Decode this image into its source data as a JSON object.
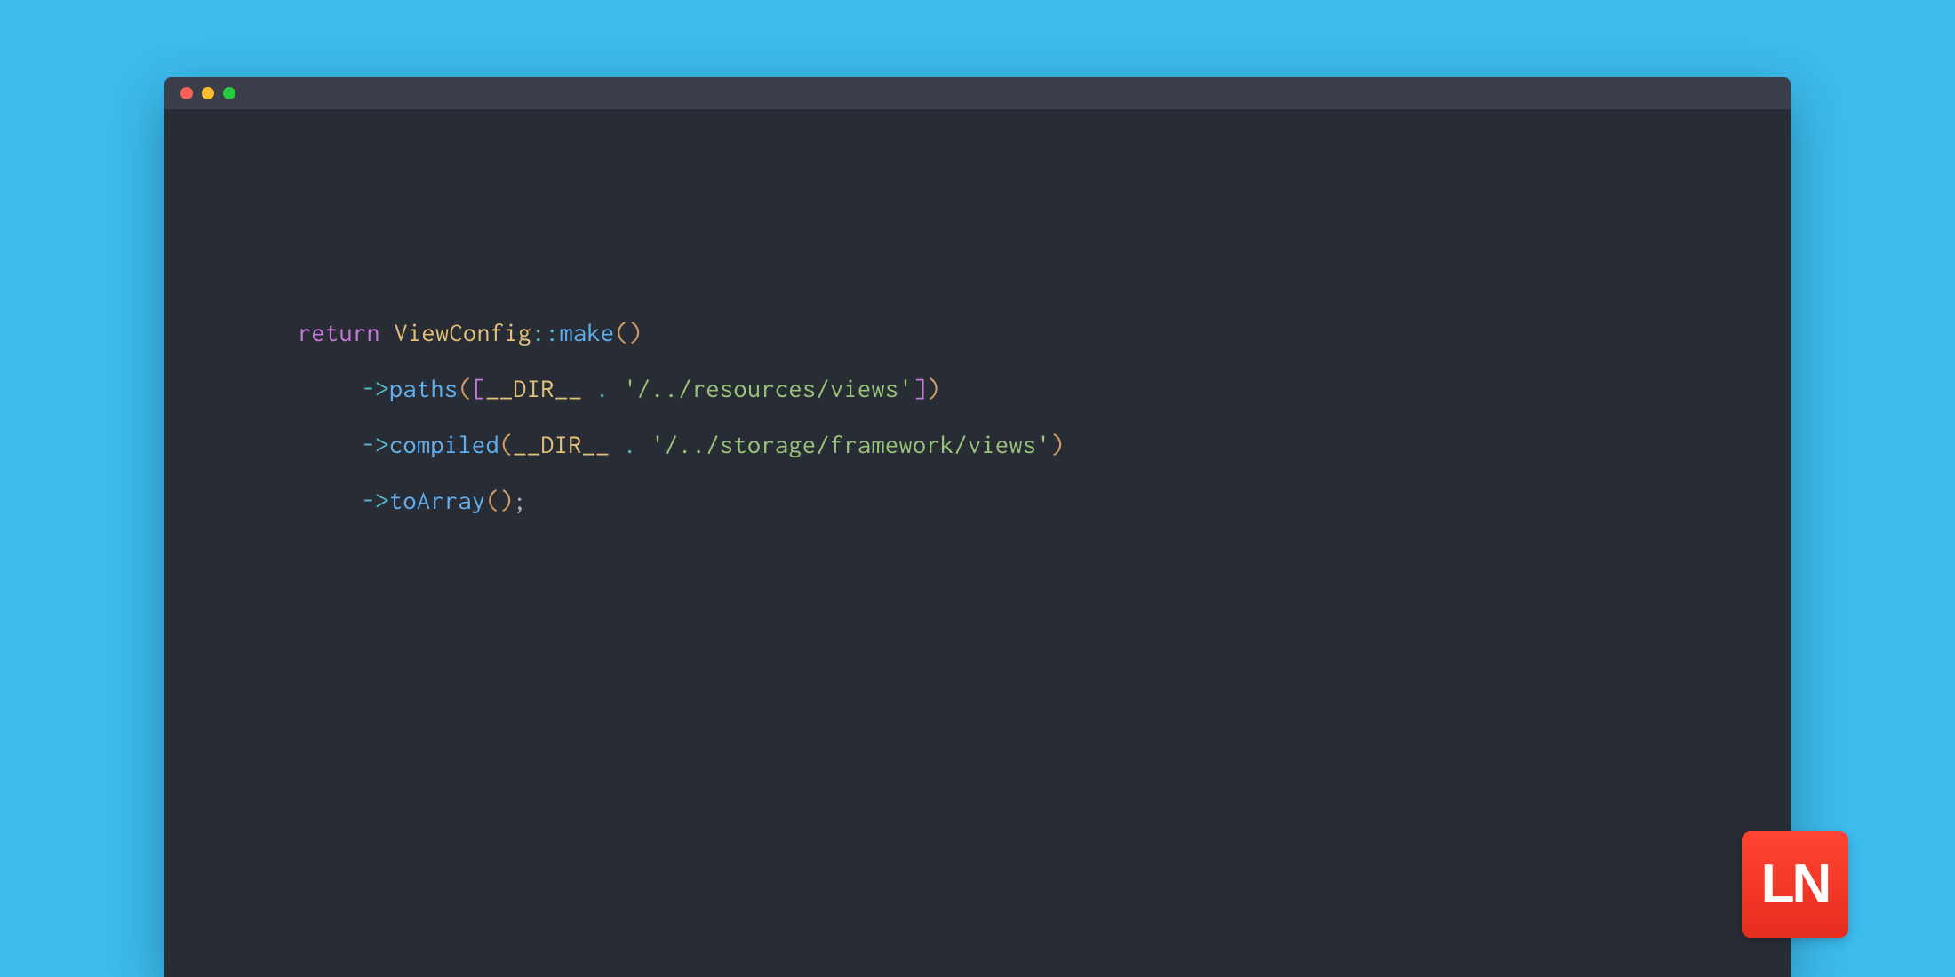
{
  "colors": {
    "background": "#3cbbed",
    "editor_bg": "#282c34",
    "titlebar_bg": "#3a3f4b",
    "traffic_close": "#ff5f56",
    "traffic_minimize": "#ffbd2e",
    "traffic_maximize": "#27c93f",
    "logo_bg": "#ff3b2f"
  },
  "logo": {
    "text": "LN"
  },
  "code": {
    "lines": [
      {
        "indent": 0,
        "tokens": [
          {
            "t": "return",
            "c": "tok-keyword"
          },
          {
            "t": " ",
            "c": "tok-punct"
          },
          {
            "t": "ViewConfig",
            "c": "tok-class"
          },
          {
            "t": "::",
            "c": "tok-operator"
          },
          {
            "t": "make",
            "c": "tok-method"
          },
          {
            "t": "(",
            "c": "tok-paren"
          },
          {
            "t": ")",
            "c": "tok-paren"
          }
        ]
      },
      {
        "indent": 1,
        "tokens": [
          {
            "t": "->",
            "c": "tok-operator"
          },
          {
            "t": "paths",
            "c": "tok-method"
          },
          {
            "t": "(",
            "c": "tok-paren"
          },
          {
            "t": "[",
            "c": "tok-bracket"
          },
          {
            "t": "__DIR__",
            "c": "tok-constant"
          },
          {
            "t": " ",
            "c": "tok-punct"
          },
          {
            "t": ".",
            "c": "tok-operator"
          },
          {
            "t": " ",
            "c": "tok-punct"
          },
          {
            "t": "'/../resources/views'",
            "c": "tok-string"
          },
          {
            "t": "]",
            "c": "tok-bracket"
          },
          {
            "t": ")",
            "c": "tok-paren"
          }
        ]
      },
      {
        "indent": 1,
        "tokens": [
          {
            "t": "->",
            "c": "tok-operator"
          },
          {
            "t": "compiled",
            "c": "tok-method"
          },
          {
            "t": "(",
            "c": "tok-paren"
          },
          {
            "t": "__DIR__",
            "c": "tok-constant"
          },
          {
            "t": " ",
            "c": "tok-punct"
          },
          {
            "t": ".",
            "c": "tok-operator"
          },
          {
            "t": " ",
            "c": "tok-punct"
          },
          {
            "t": "'/../storage/framework/views'",
            "c": "tok-string"
          },
          {
            "t": ")",
            "c": "tok-paren"
          }
        ]
      },
      {
        "indent": 1,
        "tokens": [
          {
            "t": "->",
            "c": "tok-operator"
          },
          {
            "t": "toArray",
            "c": "tok-method"
          },
          {
            "t": "(",
            "c": "tok-paren"
          },
          {
            "t": ")",
            "c": "tok-paren"
          },
          {
            "t": ";",
            "c": "tok-semicolon"
          }
        ]
      }
    ]
  }
}
